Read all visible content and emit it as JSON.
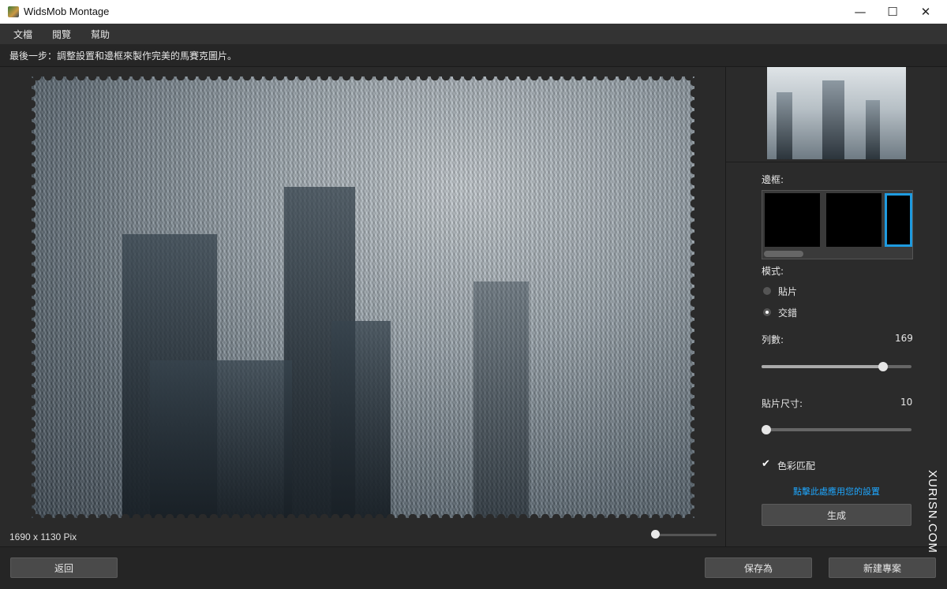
{
  "window": {
    "title": "WidsMob Montage",
    "minimize": "—",
    "maximize": "☐",
    "close": "✕"
  },
  "menu": {
    "items": [
      "文檔",
      "閱覽",
      "幫助"
    ]
  },
  "instruction": "最後一步：調整設置和邊框來製作完美的馬賽克圖片。",
  "canvas": {
    "dimensions": "1690 x 1130 Pix",
    "zoom_level": 0.02
  },
  "sidebar": {
    "border_label": "邊框:",
    "border_options": [
      "none",
      "black",
      "blue-stamp"
    ],
    "mode_label": "模式:",
    "mode_options": [
      {
        "label": "貼片",
        "selected": false
      },
      {
        "label": "交錯",
        "selected": true
      }
    ],
    "columns_label": "列數:",
    "columns_value": "169",
    "columns_fraction": 0.81,
    "tile_size_label": "貼片尺寸:",
    "tile_size_value": "10",
    "tile_size_fraction": 0.03,
    "color_match_label": "色彩匹配",
    "color_match_checked": true,
    "apply_link": "點擊此處應用您的設置",
    "generate_button": "生成"
  },
  "footer": {
    "back_button": "返回",
    "save_as_button": "保存為",
    "restart_button": "新建專案"
  },
  "watermark": "XURISN.COM",
  "colors": {
    "accent": "#1e9be0",
    "link": "#1ea7ff",
    "background": "#2a2a2a"
  }
}
